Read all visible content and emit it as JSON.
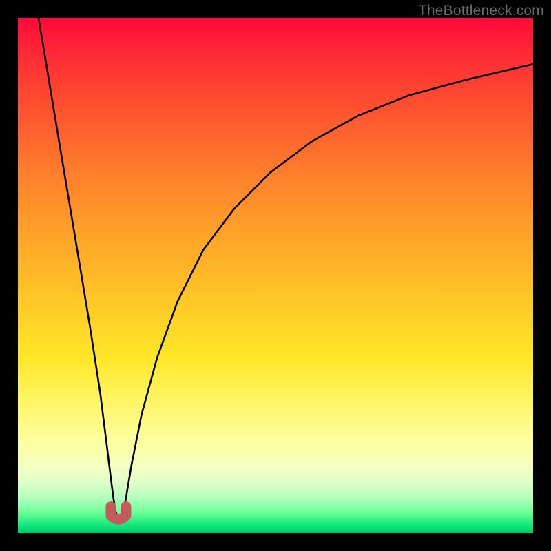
{
  "watermark": "TheBottleneck.com",
  "chart_data": {
    "type": "line",
    "title": "",
    "xlabel": "",
    "ylabel": "",
    "xlim": [
      0,
      100
    ],
    "ylim": [
      0,
      100
    ],
    "series": [
      {
        "name": "bottleneck-curve",
        "x": [
          4,
          6,
          8,
          10,
          12,
          14,
          16,
          17,
          18,
          18.5,
          19,
          19.5,
          20,
          20.5,
          21,
          22,
          24,
          27,
          31,
          36,
          42,
          49,
          57,
          66,
          76,
          87,
          100
        ],
        "values": [
          100,
          88,
          76,
          64,
          52,
          40,
          27,
          19,
          11,
          7,
          4,
          3,
          3,
          4,
          7,
          13,
          23,
          34,
          45,
          55,
          63,
          70,
          76,
          81,
          85,
          88,
          91
        ]
      }
    ],
    "marker": {
      "name": "optimal-point",
      "x": 19.5,
      "y": 3,
      "color": "#c65a5a"
    },
    "colors": {
      "curve": "#000000",
      "background_top": "#ff0a3a",
      "background_bottom": "#00c86a"
    }
  }
}
